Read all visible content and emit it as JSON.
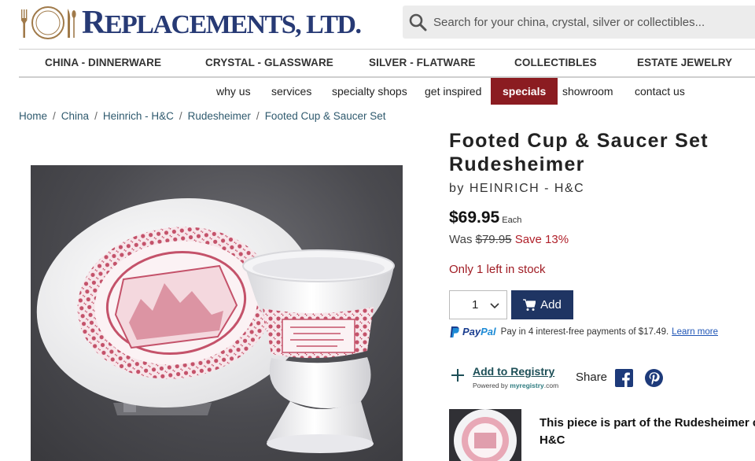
{
  "brand": {
    "logo_text_big": "R",
    "logo_text_rest": "EPLACEMENTS, ",
    "logo_text_ltd": "LTD."
  },
  "search": {
    "placeholder": "Search for your china, crystal, silver or collectibles...",
    "icon": "search-icon"
  },
  "main_nav": [
    "CHINA - DINNERWARE",
    "CRYSTAL - GLASSWARE",
    "SILVER - FLATWARE",
    "COLLECTIBLES",
    "ESTATE JEWELRY"
  ],
  "sub_nav": {
    "items": [
      "why us",
      "services",
      "specialty shops",
      "get inspired",
      "specials",
      "showroom",
      "contact us"
    ],
    "active": "specials"
  },
  "breadcrumb": [
    "Home",
    "China",
    "Heinrich - H&C",
    "Rudesheimer",
    "Footed Cup & Saucer Set"
  ],
  "product": {
    "title_line1": "Footed Cup & Saucer Set",
    "title_line2": "Rudesheimer",
    "by": "by HEINRICH - H&C",
    "price": "$69.95",
    "price_unit": "Each",
    "was_label": "Was",
    "was_price": "$79.95",
    "save": "Save 13%",
    "stock": "Only 1 left in stock",
    "quantity": "1",
    "add_label": "Add"
  },
  "paypal": {
    "brand_pay": "Pay",
    "brand_pal": "Pal",
    "message": "Pay in 4 interest-free payments of $17.49.",
    "link": "Learn more"
  },
  "registry": {
    "link": "Add to Registry",
    "powered_by": "Powered by",
    "powered_brand": "myregistry",
    "powered_suffix": ".com"
  },
  "share": {
    "label": "Share"
  },
  "collection": {
    "text_line1": "This piece is part of the Rudesheimer colle",
    "text_line2": "H&C"
  },
  "colors": {
    "logo_blue": "#273a75",
    "active_nav": "#8b1c21",
    "add_button": "#1f3563",
    "sale_red": "#b0202a",
    "link_teal": "#2f5a6e"
  }
}
